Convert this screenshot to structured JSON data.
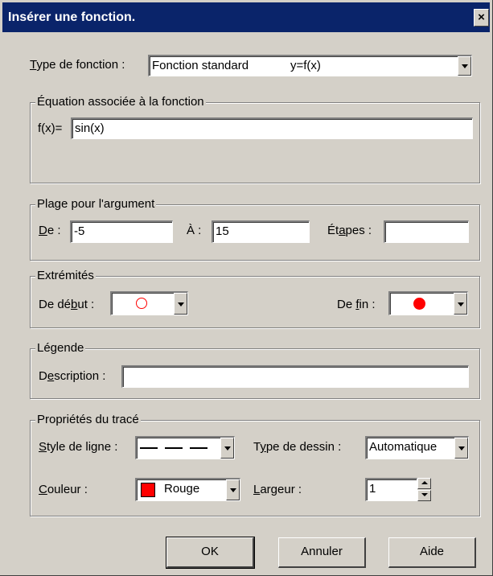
{
  "window": {
    "title": "Insérer une fonction.",
    "close_glyph": "×"
  },
  "type_fonction": {
    "label_first": "T",
    "label_rest": "ype de fonction :",
    "selected_name": "Fonction standard",
    "selected_formula": "y=f(x)"
  },
  "equation": {
    "group_title": "Équation associée à la fonction",
    "prefix": "f(x)=",
    "value": "sin(x)"
  },
  "plage": {
    "group_title": "Plage pour l'argument",
    "de_label_first": "D",
    "de_label_rest": "e :",
    "de_value": "-5",
    "a_label": "À :",
    "a_value": "15",
    "etapes_label_before": "Ét",
    "etapes_label_u": "a",
    "etapes_label_after": "pes :",
    "etapes_value": ""
  },
  "extremites": {
    "group_title": "Extrémités",
    "debut_label_before": "De dé",
    "debut_label_u": "b",
    "debut_label_after": "ut :",
    "debut_marker": "open-circle",
    "fin_label_before": "De ",
    "fin_label_u": "f",
    "fin_label_after": "in :",
    "fin_marker": "filled-circle",
    "marker_color": "#ff0000"
  },
  "legende": {
    "group_title": "Légende",
    "description_label_before": "D",
    "description_label_u": "e",
    "description_label_after": "scription :",
    "description_value": ""
  },
  "proprietes": {
    "group_title": "Propriétés du tracé",
    "style_label_u": "S",
    "style_label_rest": "tyle de ligne :",
    "style_value": "dashed",
    "type_dessin_label_before": "T",
    "type_dessin_label_u": "y",
    "type_dessin_label_after": "pe de dessin :",
    "type_dessin_value": "Automatique",
    "couleur_label_u": "C",
    "couleur_label_rest": "ouleur :",
    "couleur_value": "Rouge",
    "couleur_swatch": "#ff0000",
    "largeur_label_u": "L",
    "largeur_label_rest": "argeur :",
    "largeur_value": "1"
  },
  "buttons": {
    "ok": "OK",
    "annuler": "Annuler",
    "aide": "Aide"
  }
}
